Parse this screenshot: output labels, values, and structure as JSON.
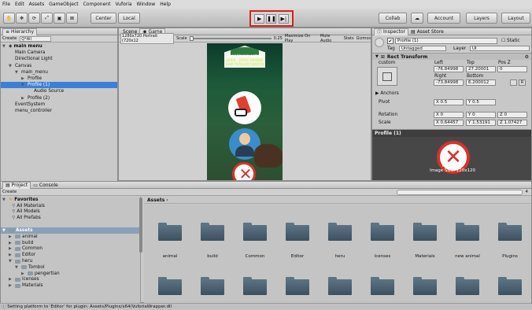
{
  "menu": [
    "File",
    "Edit",
    "Assets",
    "GameObject",
    "Component",
    "Vuforia",
    "Window",
    "Help"
  ],
  "toolbar": {
    "pivot": "Center",
    "space": "Local",
    "collab": "Collab",
    "account": "Account",
    "layers": "Layers",
    "layout": "Layout"
  },
  "hierarchy": {
    "tab": "Hierarchy",
    "create": "Create",
    "search": "Q*All",
    "items": [
      {
        "label": "main menu",
        "depth": 0,
        "arrow": "▼",
        "scene": true
      },
      {
        "label": "Main Camera",
        "depth": 1,
        "arrow": ""
      },
      {
        "label": "Directional Light",
        "depth": 1,
        "arrow": ""
      },
      {
        "label": "Canvas",
        "depth": 1,
        "arrow": "▼"
      },
      {
        "label": "main_menu",
        "depth": 2,
        "arrow": "▼"
      },
      {
        "label": "Profile",
        "depth": 3,
        "arrow": "▶"
      },
      {
        "label": "Profile (1)",
        "depth": 3,
        "arrow": "▼",
        "selected": true
      },
      {
        "label": "Audio Source",
        "depth": 4,
        "arrow": ""
      },
      {
        "label": "Profile (2)",
        "depth": 3,
        "arrow": "▶"
      },
      {
        "label": "EventSystem",
        "depth": 1,
        "arrow": ""
      },
      {
        "label": "menu_controller",
        "depth": 1,
        "arrow": ""
      }
    ]
  },
  "game": {
    "scene_tab": "Scene",
    "game_tab": "Game",
    "resolution": "1280x720 Portrait (720x12",
    "scale_label": "Scale",
    "scale_value": "0.25",
    "maximize": "Maximize On Play",
    "mute": "Mute Audio",
    "stats": "Stats",
    "gizmos": "Gizmos",
    "banner_lines": [
      "KONSERVASI SATWA",
      "JENIS - JENIS HEWAN",
      "DAN PENGERTIANNYA"
    ]
  },
  "inspector": {
    "tab": "Inspector",
    "asset_store": "Asset Store",
    "name": "Profile (1)",
    "static": "Static",
    "tag_label": "Tag",
    "tag": "Untagged",
    "layer_label": "Layer",
    "layer": "UI",
    "component": "Rect Transform",
    "custom": "custom",
    "col_left": "Left",
    "col_top": "Top",
    "col_posz": "Pos Z",
    "left": "-76.84998",
    "top": "27.20001",
    "posz": "0",
    "col_right": "Right",
    "col_bottom": "Bottom",
    "right": "-73.84998",
    "bottom": "6.200012",
    "anchors": "Anchors",
    "pivot": "Pivot",
    "pivot_x": "0.5",
    "pivot_y": "0.5",
    "rotation": "Rotation",
    "rot_x": "0",
    "rot_y": "0",
    "rot_z": "0",
    "scale": "Scale",
    "scale_x": "0.64457",
    "scale_y": "1.53191",
    "scale_z": "1.07427",
    "preview_tab": "Profile (1)",
    "preview_caption1": "Profile (1)",
    "preview_caption2": "Image Size: 120x120"
  },
  "project": {
    "tab": "Project",
    "console_tab": "Console",
    "create": "Create",
    "count": "4",
    "favorites": "Favorites",
    "fav_items": [
      "All Materials",
      "All Models",
      "All Prefabs"
    ],
    "assets": "Assets",
    "tree": [
      {
        "label": "animal",
        "d": 1
      },
      {
        "label": "build",
        "d": 1
      },
      {
        "label": "Common",
        "d": 1
      },
      {
        "label": "Editor",
        "d": 1
      },
      {
        "label": "heru",
        "d": 1,
        "open": true
      },
      {
        "label": "Tombol",
        "d": 2,
        "open": true
      },
      {
        "label": "pengertian",
        "d": 3
      },
      {
        "label": "lcenses",
        "d": 1
      },
      {
        "label": "Materials",
        "d": 1
      }
    ],
    "breadcrumb": "Assets",
    "folders": [
      "animal",
      "build",
      "Common",
      "Editor",
      "heru",
      "lcenses",
      "Materials",
      "new animal",
      "Plugins"
    ]
  },
  "status": "Setting platform to 'Editor' for plugin: Assets/Plugins/x64/VuforiaWrapper.dll"
}
